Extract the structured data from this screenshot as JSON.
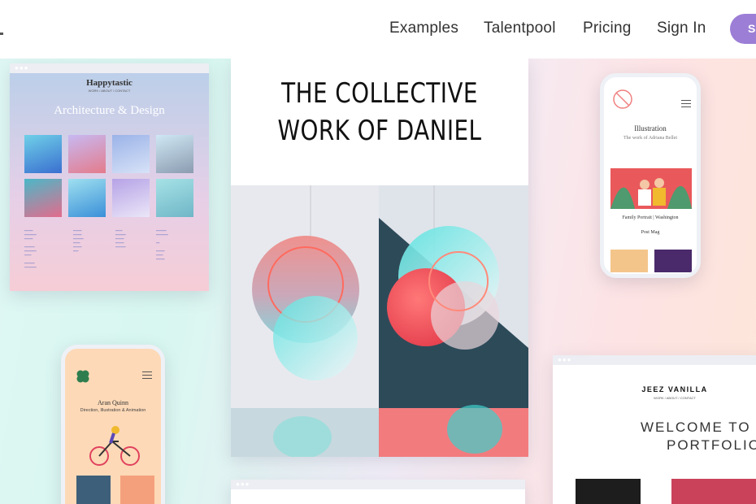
{
  "nav": {
    "links": [
      "Examples",
      "Talentpool",
      "Pricing",
      "Sign In"
    ],
    "cta": "S"
  },
  "card_happytastic": {
    "brand": "Happytastic",
    "nav": "WORK / ABOUT / CONTACT",
    "title": "Architecture & Design"
  },
  "card_daniel": {
    "title_line1": "THE COLLECTIVE",
    "title_line2": "WORK OF DANIEL"
  },
  "phone_illustration": {
    "title": "Illustration",
    "subtitle": "The work of Adriana Bellet",
    "caption1": "Family Portrait | Washington",
    "caption2": "Post Mag"
  },
  "phone_aran": {
    "name": "Aran Quinn",
    "subtitle": "Direction, Illustration & Animation"
  },
  "card_jeez": {
    "brand": "JEEZ VANILLA",
    "nav": "WORK / ABOUT / CONTACT",
    "welcome_line1": "WELCOME TO",
    "welcome_line2": "PORTFOLIO"
  },
  "colors": {
    "accent": "#9c7ed6"
  }
}
